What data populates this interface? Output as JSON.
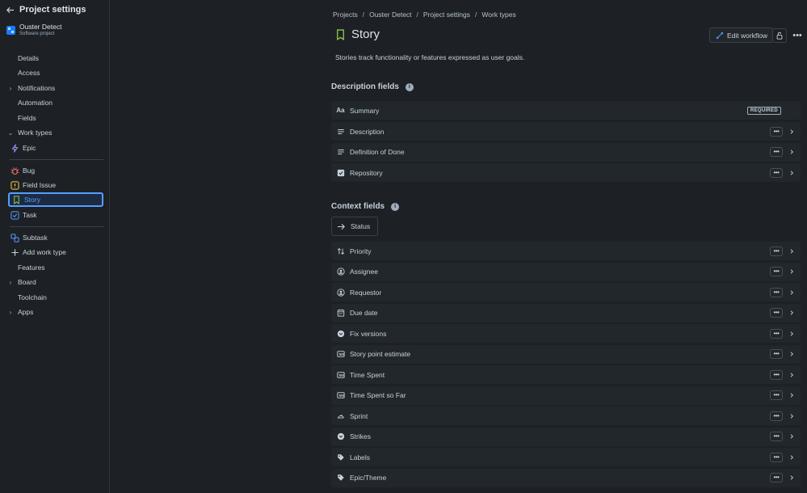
{
  "sidebar": {
    "title": "Project settings",
    "project": {
      "name": "Ouster Detect",
      "subtitle": "Software project"
    },
    "nav": [
      {
        "label": "Details",
        "chevron": ""
      },
      {
        "label": "Access",
        "chevron": ""
      },
      {
        "label": "Notifications",
        "chevron": "›"
      },
      {
        "label": "Automation",
        "chevron": ""
      },
      {
        "label": "Fields",
        "chevron": ""
      },
      {
        "label": "Work types",
        "chevron": "⌄"
      }
    ],
    "work_types": [
      {
        "label": "Epic",
        "icon": "epic-icon",
        "color": "#9f8fef"
      },
      {
        "label": "Bug",
        "icon": "bug-icon",
        "color": "#f87168"
      },
      {
        "label": "Field Issue",
        "icon": "field-issue-icon",
        "color": "#f5cd47"
      },
      {
        "label": "Story",
        "icon": "story-icon",
        "color": "#94c748"
      },
      {
        "label": "Task",
        "icon": "task-icon",
        "color": "#579dff"
      },
      {
        "label": "Subtask",
        "icon": "subtask-icon",
        "color": "#579dff"
      },
      {
        "label": "Add work type",
        "icon": "plus-icon",
        "color": "#c7d1db"
      }
    ],
    "nav_bottom": [
      {
        "label": "Features",
        "chevron": ""
      },
      {
        "label": "Board",
        "chevron": "›"
      },
      {
        "label": "Toolchain",
        "chevron": ""
      },
      {
        "label": "Apps",
        "chevron": "›"
      }
    ]
  },
  "breadcrumb": [
    "Projects",
    "Ouster Detect",
    "Project settings",
    "Work types"
  ],
  "header": {
    "title": "Story",
    "edit_workflow": "Edit workflow",
    "description": "Stories track functionality or features expressed as user goals."
  },
  "description_fields": {
    "heading": "Description fields",
    "required_label": "REQUIRED",
    "items": [
      {
        "label": "Summary",
        "icon": "text-aa-icon"
      },
      {
        "label": "Description",
        "icon": "paragraph-icon"
      },
      {
        "label": "Definition of Done",
        "icon": "paragraph-icon"
      },
      {
        "label": "Repository",
        "icon": "checkbox-icon"
      }
    ]
  },
  "context_fields": {
    "heading": "Context fields",
    "status_label": "Status",
    "items": [
      {
        "label": "Priority",
        "icon": "priority-icon"
      },
      {
        "label": "Assignee",
        "icon": "person-icon"
      },
      {
        "label": "Requestor",
        "icon": "person-icon"
      },
      {
        "label": "Due date",
        "icon": "calendar-icon"
      },
      {
        "label": "Fix versions",
        "icon": "dropdown-circle-icon"
      },
      {
        "label": "Story point estimate",
        "icon": "number-icon"
      },
      {
        "label": "Time Spent",
        "icon": "number-icon"
      },
      {
        "label": "Time Spent so Far",
        "icon": "number-icon"
      },
      {
        "label": "Sprint",
        "icon": "sprint-icon"
      },
      {
        "label": "Strikes",
        "icon": "dropdown-circle-icon"
      },
      {
        "label": "Labels",
        "icon": "tag-icon"
      },
      {
        "label": "Epic/Theme",
        "icon": "tag-icon"
      }
    ]
  }
}
